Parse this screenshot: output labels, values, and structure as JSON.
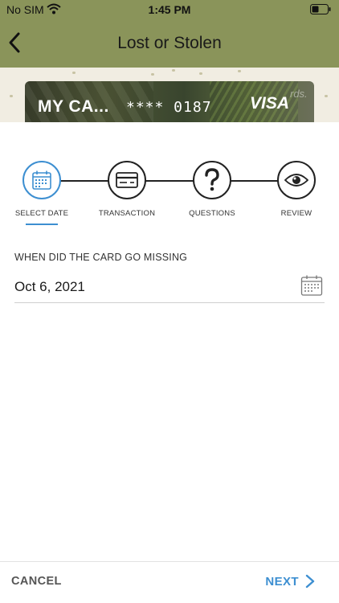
{
  "status_bar": {
    "carrier": "No SIM",
    "time": "1:45 PM"
  },
  "nav": {
    "title": "Lost or Stolen",
    "back_icon": "chevron-left-icon"
  },
  "card": {
    "name": "MY CA...",
    "number": "**** 0187",
    "brand": "VISA",
    "watermark": "rds."
  },
  "stepper": {
    "active_step": 0,
    "steps": [
      {
        "label": "SELECT DATE",
        "icon": "calendar-icon"
      },
      {
        "label": "TRANSACTION",
        "icon": "credit-card-icon"
      },
      {
        "label": "QUESTIONS",
        "icon": "question-mark-icon"
      },
      {
        "label": "REVIEW",
        "icon": "eye-icon"
      }
    ]
  },
  "form": {
    "label": "WHEN DID THE CARD GO MISSING",
    "date_value": "Oct 6, 2021"
  },
  "footer": {
    "cancel_label": "CANCEL",
    "next_label": "NEXT"
  },
  "colors": {
    "header_bg": "#8a945a",
    "accent": "#3d8fd1",
    "banner_bg": "#f1ede2"
  }
}
